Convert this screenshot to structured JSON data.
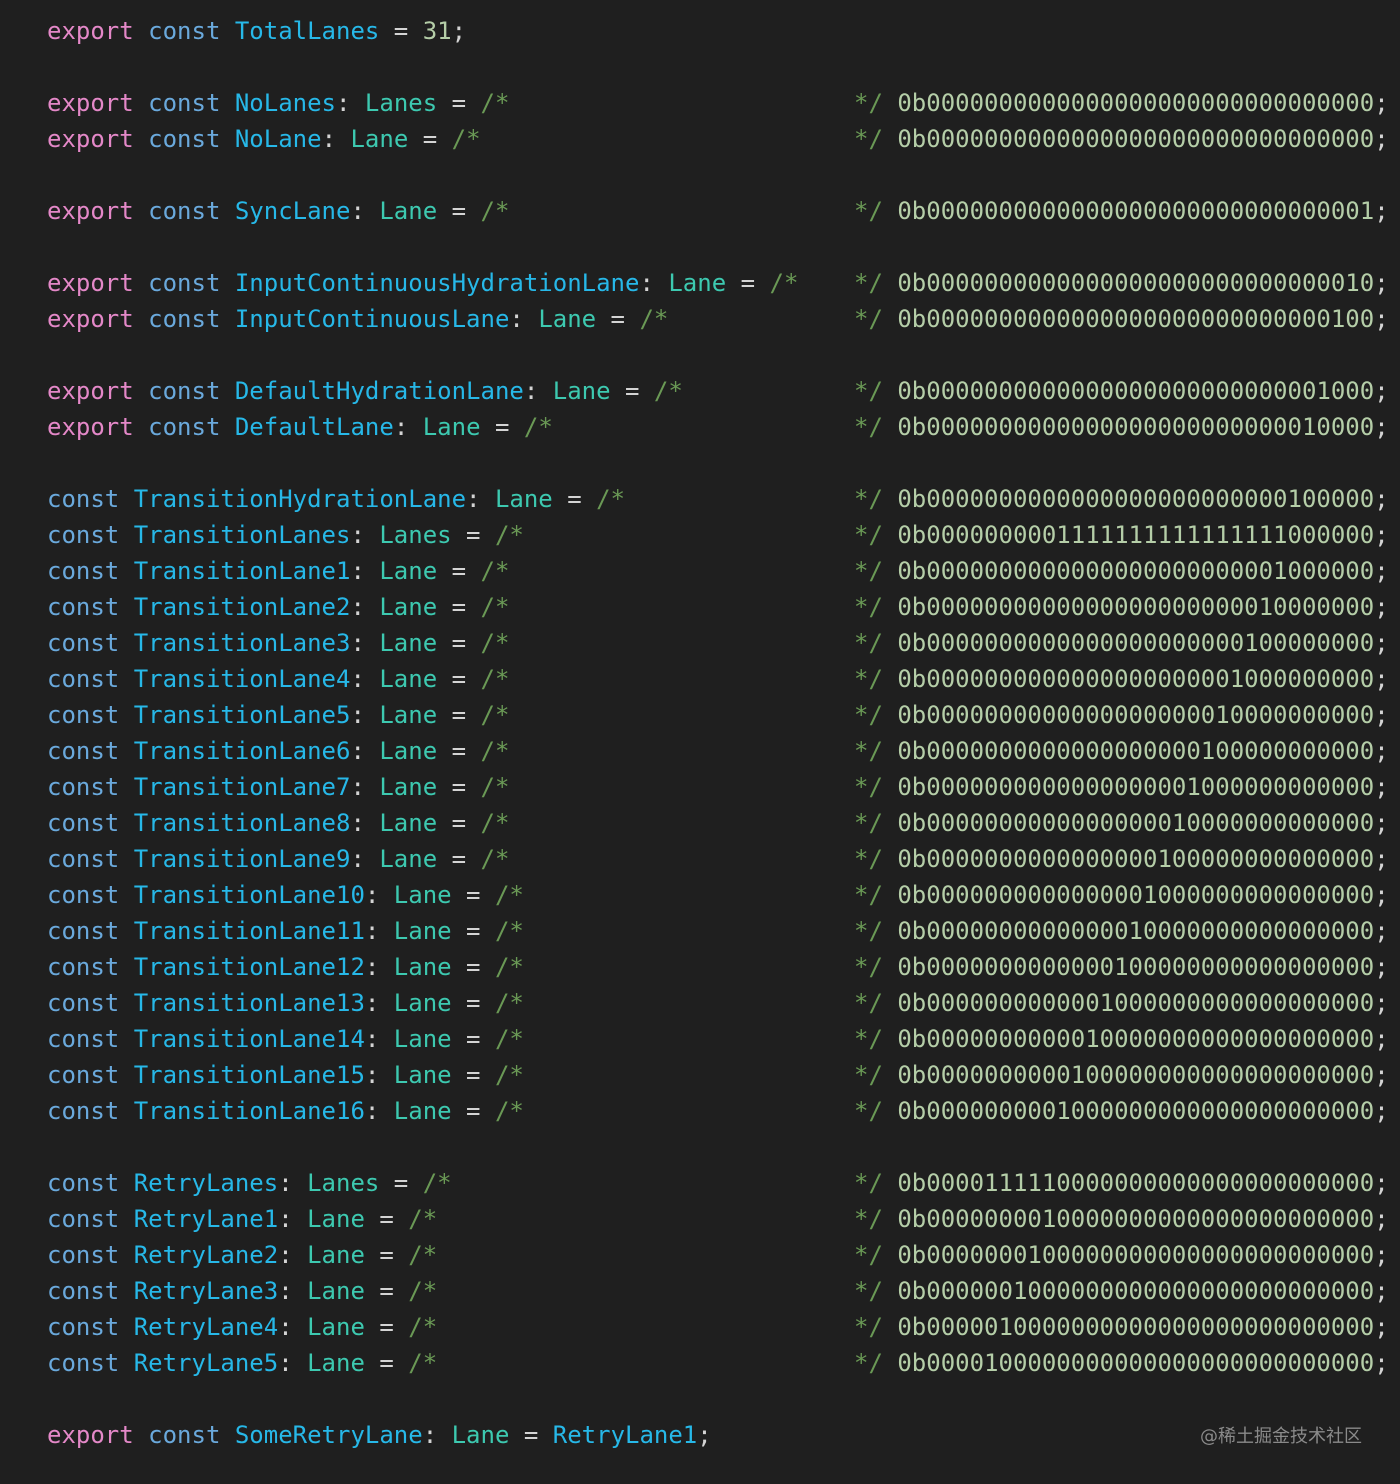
{
  "theme": {
    "background": "#1f1f1f",
    "keyword_export": "#e488c8",
    "keyword_const": "#6aa9dc",
    "identifier": "#27b8e8",
    "type": "#3dc9b0",
    "punctuation": "#d4d4d4",
    "comment": "#6a9955",
    "number": "#b5cea8"
  },
  "code": {
    "total": {
      "export": "export",
      "const": "const",
      "name": "TotalLanes",
      "eq": " = ",
      "value": "31",
      "end": ";"
    },
    "lines": [
      {
        "export": "export",
        "const": "const",
        "name": "NoLanes",
        "type": "Lanes",
        "value": "0b0000000000000000000000000000000"
      },
      {
        "export": "export",
        "const": "const",
        "name": "NoLane",
        "type": "Lane",
        "value": "0b0000000000000000000000000000000"
      },
      {
        "export": "export",
        "const": "const",
        "name": "SyncLane",
        "type": "Lane",
        "value": "0b0000000000000000000000000000001"
      },
      {
        "export": "export",
        "const": "const",
        "name": "InputContinuousHydrationLane",
        "type": "Lane",
        "value": "0b0000000000000000000000000000010"
      },
      {
        "export": "export",
        "const": "const",
        "name": "InputContinuousLane",
        "type": "Lane",
        "value": "0b0000000000000000000000000000100"
      },
      {
        "export": "export",
        "const": "const",
        "name": "DefaultHydrationLane",
        "type": "Lane",
        "value": "0b0000000000000000000000000001000"
      },
      {
        "export": "export",
        "const": "const",
        "name": "DefaultLane",
        "type": "Lane",
        "value": "0b0000000000000000000000000010000"
      },
      {
        "export": "",
        "const": "const",
        "name": "TransitionHydrationLane",
        "type": "Lane",
        "value": "0b0000000000000000000000000100000"
      },
      {
        "export": "",
        "const": "const",
        "name": "TransitionLanes",
        "type": "Lanes",
        "value": "0b0000000001111111111111111000000"
      },
      {
        "export": "",
        "const": "const",
        "name": "TransitionLane1",
        "type": "Lane",
        "value": "0b0000000000000000000000001000000"
      },
      {
        "export": "",
        "const": "const",
        "name": "TransitionLane2",
        "type": "Lane",
        "value": "0b0000000000000000000000010000000"
      },
      {
        "export": "",
        "const": "const",
        "name": "TransitionLane3",
        "type": "Lane",
        "value": "0b0000000000000000000000100000000"
      },
      {
        "export": "",
        "const": "const",
        "name": "TransitionLane4",
        "type": "Lane",
        "value": "0b0000000000000000000001000000000"
      },
      {
        "export": "",
        "const": "const",
        "name": "TransitionLane5",
        "type": "Lane",
        "value": "0b0000000000000000000010000000000"
      },
      {
        "export": "",
        "const": "const",
        "name": "TransitionLane6",
        "type": "Lane",
        "value": "0b0000000000000000000100000000000"
      },
      {
        "export": "",
        "const": "const",
        "name": "TransitionLane7",
        "type": "Lane",
        "value": "0b0000000000000000001000000000000"
      },
      {
        "export": "",
        "const": "const",
        "name": "TransitionLane8",
        "type": "Lane",
        "value": "0b0000000000000000010000000000000"
      },
      {
        "export": "",
        "const": "const",
        "name": "TransitionLane9",
        "type": "Lane",
        "value": "0b0000000000000000100000000000000"
      },
      {
        "export": "",
        "const": "const",
        "name": "TransitionLane10",
        "type": "Lane",
        "value": "0b0000000000000001000000000000000"
      },
      {
        "export": "",
        "const": "const",
        "name": "TransitionLane11",
        "type": "Lane",
        "value": "0b0000000000000010000000000000000"
      },
      {
        "export": "",
        "const": "const",
        "name": "TransitionLane12",
        "type": "Lane",
        "value": "0b0000000000000100000000000000000"
      },
      {
        "export": "",
        "const": "const",
        "name": "TransitionLane13",
        "type": "Lane",
        "value": "0b0000000000001000000000000000000"
      },
      {
        "export": "",
        "const": "const",
        "name": "TransitionLane14",
        "type": "Lane",
        "value": "0b0000000000010000000000000000000"
      },
      {
        "export": "",
        "const": "const",
        "name": "TransitionLane15",
        "type": "Lane",
        "value": "0b0000000000100000000000000000000"
      },
      {
        "export": "",
        "const": "const",
        "name": "TransitionLane16",
        "type": "Lane",
        "value": "0b0000000001000000000000000000000"
      },
      {
        "export": "",
        "const": "const",
        "name": "RetryLanes",
        "type": "Lanes",
        "value": "0b0000111110000000000000000000000"
      },
      {
        "export": "",
        "const": "const",
        "name": "RetryLane1",
        "type": "Lane",
        "value": "0b0000000010000000000000000000000"
      },
      {
        "export": "",
        "const": "const",
        "name": "RetryLane2",
        "type": "Lane",
        "value": "0b0000000100000000000000000000000"
      },
      {
        "export": "",
        "const": "const",
        "name": "RetryLane3",
        "type": "Lane",
        "value": "0b0000001000000000000000000000000"
      },
      {
        "export": "",
        "const": "const",
        "name": "RetryLane4",
        "type": "Lane",
        "value": "0b0000010000000000000000000000000"
      },
      {
        "export": "",
        "const": "const",
        "name": "RetryLane5",
        "type": "Lane",
        "value": "0b0000100000000000000000000000000"
      }
    ],
    "comment_open": "/*",
    "comment_close": "*/",
    "semicolon": ";",
    "last": {
      "export": "export",
      "const": "const",
      "name": "SomeRetryLane",
      "type": "Lane",
      "value": "RetryLane1",
      "end": ";"
    }
  },
  "watermark": "@稀土掘金技术社区"
}
